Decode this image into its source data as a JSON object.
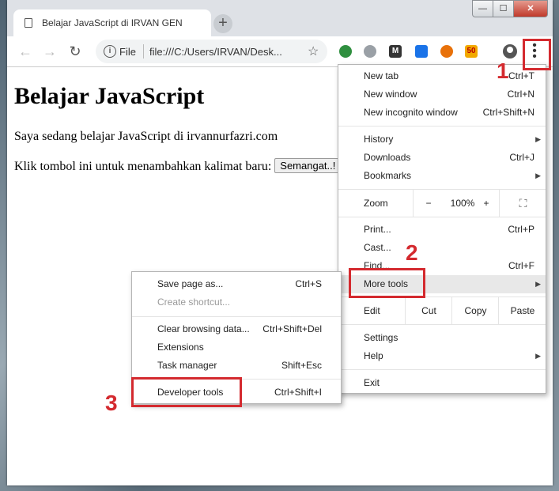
{
  "tab": {
    "title": "Belajar JavaScript di IRVAN GEN"
  },
  "window_controls": {
    "minimize": "—",
    "maximize": "☐",
    "close": "✕"
  },
  "toolbar": {
    "back_icon": "arrow-left-icon",
    "forward_icon": "arrow-right-icon",
    "reload_icon": "reload-icon",
    "scheme_label": "File",
    "url": "file:///C:/Users/IRVAN/Desk...",
    "extensions": [
      {
        "name": "idm-icon",
        "color": "#2f8f3f"
      },
      {
        "name": "globe-icon",
        "color": "#9aa0a6"
      },
      {
        "name": "m-icon",
        "color": "#333333",
        "glyph": "M"
      },
      {
        "name": "share-icon",
        "color": "#1a73e8"
      },
      {
        "name": "sync-icon",
        "color": "#e8710a"
      },
      {
        "name": "badge-icon",
        "color": "#f2a900",
        "glyph": "50"
      }
    ]
  },
  "page": {
    "heading": "Belajar JavaScript",
    "line1": "Saya sedang belajar JavaScript di irvannurfazri.com",
    "line2": "Klik tombol ini untuk menambahkan kalimat baru:",
    "button": "Semangat..!"
  },
  "main_menu": {
    "new_tab": {
      "label": "New tab",
      "shortcut": "Ctrl+T"
    },
    "new_window": {
      "label": "New window",
      "shortcut": "Ctrl+N"
    },
    "incognito": {
      "label": "New incognito window",
      "shortcut": "Ctrl+Shift+N"
    },
    "history": {
      "label": "History"
    },
    "downloads": {
      "label": "Downloads",
      "shortcut": "Ctrl+J"
    },
    "bookmarks": {
      "label": "Bookmarks"
    },
    "zoom": {
      "label": "Zoom",
      "minus": "−",
      "level": "100%",
      "plus": "+"
    },
    "print": {
      "label": "Print...",
      "shortcut": "Ctrl+P"
    },
    "cast": {
      "label": "Cast..."
    },
    "find": {
      "label": "Find...",
      "shortcut": "Ctrl+F"
    },
    "more_tools": {
      "label": "More tools"
    },
    "edit": {
      "label": "Edit",
      "cut": "Cut",
      "copy": "Copy",
      "paste": "Paste"
    },
    "settings": {
      "label": "Settings"
    },
    "help": {
      "label": "Help"
    },
    "exit": {
      "label": "Exit"
    }
  },
  "sub_menu": {
    "save_page": {
      "label": "Save page as...",
      "shortcut": "Ctrl+S"
    },
    "create_shortcut": {
      "label": "Create shortcut..."
    },
    "clear_data": {
      "label": "Clear browsing data...",
      "shortcut": "Ctrl+Shift+Del"
    },
    "extensions": {
      "label": "Extensions"
    },
    "task_manager": {
      "label": "Task manager",
      "shortcut": "Shift+Esc"
    },
    "dev_tools": {
      "label": "Developer tools",
      "shortcut": "Ctrl+Shift+I"
    }
  },
  "annotations": {
    "step1": "1",
    "step2": "2",
    "step3": "3"
  }
}
